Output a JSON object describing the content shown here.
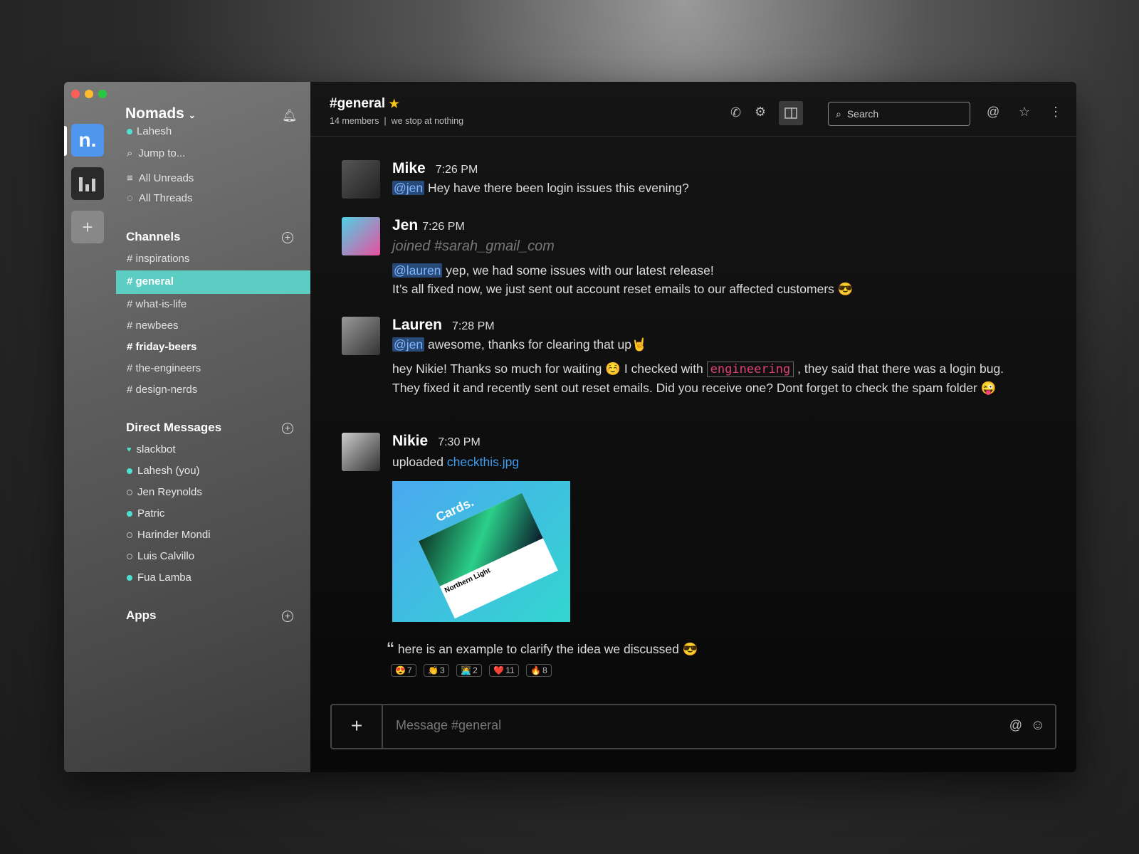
{
  "window": {
    "controls": [
      "close",
      "minimize",
      "maximize"
    ]
  },
  "workspaces": [
    {
      "label": "n.",
      "color": "#4f96ef"
    },
    {
      "label": "analytics",
      "color": "#2a2a2a"
    },
    {
      "label": "+",
      "color": "#888"
    }
  ],
  "sidebar": {
    "team": "Nomads",
    "user": "Lahesh",
    "jump": "Jump to...",
    "all_unreads": "All Unreads",
    "all_threads": "All Threads",
    "channels_title": "Channels",
    "channels": [
      {
        "label": "# inspirations"
      },
      {
        "label": "# general"
      },
      {
        "label": "# what-is-life"
      },
      {
        "label": "# newbees"
      },
      {
        "label": "# friday-beers"
      },
      {
        "label": "# the-engineers"
      },
      {
        "label": "# design-nerds"
      }
    ],
    "dm_title": "Direct Messages",
    "dms": [
      {
        "label": "slackbot",
        "status": "heart"
      },
      {
        "label": "Lahesh (you)",
        "status": "online"
      },
      {
        "label": "Jen Reynolds",
        "status": "away"
      },
      {
        "label": "Patric",
        "status": "online"
      },
      {
        "label": "Harinder Mondi",
        "status": "away"
      },
      {
        "label": "Luis Calvillo",
        "status": "away"
      },
      {
        "label": "Fua Lamba",
        "status": "online"
      }
    ],
    "apps_title": "Apps",
    "accent": "#5ccdc3"
  },
  "header": {
    "title": "#general",
    "members": "14 members",
    "topic": "we stop at nothing",
    "search_placeholder": "Search"
  },
  "messages": [
    {
      "name": "Mike",
      "time": "7:26 PM",
      "mention": "@jen",
      "text": "Hey have there been login issues this evening?"
    },
    {
      "name": "Jen",
      "time": "7:26 PM",
      "joined": "joined #sarah_gmail_com",
      "mention": "@lauren",
      "text": "yep, we had some issues with our latest release!",
      "text2": "It’s all fixed now, we just sent out account reset emails to our affected customers 😎"
    },
    {
      "name": "Lauren",
      "time": "7:28 PM",
      "mention": "@jen",
      "text": "awesome, thanks for clearing that up🤘",
      "text2a": "hey Nikie! Thanks so much for waiting ☺️ I checked with",
      "code": "engineering",
      "text2b": ", they said that there was a login bug. They fixed it and recently sent out reset emails. Did you receive one? Dont forget to check the spam folder 😜"
    },
    {
      "name": "Nikie",
      "time": "7:30 PM",
      "uploaded": "uploaded",
      "file": "checkthis.jpg",
      "image_text": "Cards.",
      "image_caption": "Northern Light",
      "quote": "here is an example to clarify the idea we discussed 😎",
      "reactions": [
        {
          "emoji": "😍",
          "count": "7"
        },
        {
          "emoji": "👏",
          "count": "3"
        },
        {
          "emoji": "👩‍💻",
          "count": "2"
        },
        {
          "emoji": "❤️",
          "count": "11"
        },
        {
          "emoji": "🔥",
          "count": "8"
        }
      ]
    }
  ],
  "composer": {
    "placeholder": "Message #general"
  }
}
